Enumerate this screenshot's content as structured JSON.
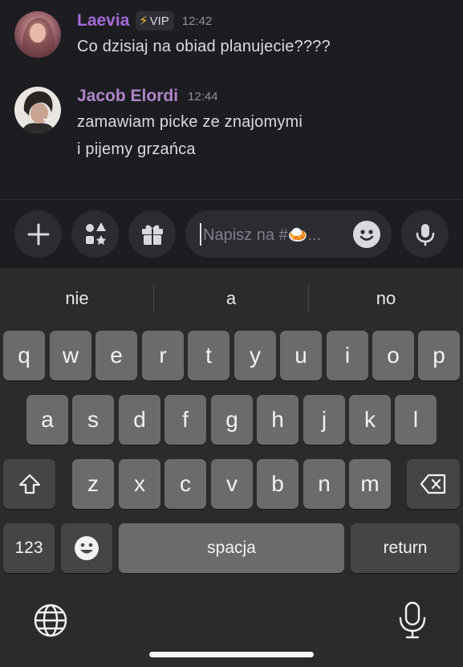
{
  "chat": {
    "messages": [
      {
        "author": "Laevia",
        "badge": {
          "icon": "lightning-bolt-icon",
          "glyph": "⚡",
          "label": "VIP"
        },
        "time": "12:42",
        "lines": [
          "Co dzisiaj na obiad planujecie????"
        ]
      },
      {
        "author": "Jacob Elordi",
        "time": "12:44",
        "lines": [
          "zamawiam picke ze znajomymi",
          "i pijemy grzańca"
        ]
      }
    ]
  },
  "composer": {
    "placeholder": "Napisz na #🍛...",
    "buttons": [
      "plus-icon",
      "apps-icon",
      "gift-icon",
      "emoji-icon",
      "microphone-icon"
    ]
  },
  "keyboard": {
    "suggestions": [
      "nie",
      "a",
      "no"
    ],
    "rows": [
      [
        "q",
        "w",
        "e",
        "r",
        "t",
        "y",
        "u",
        "i",
        "o",
        "p"
      ],
      [
        "a",
        "s",
        "d",
        "f",
        "g",
        "h",
        "j",
        "k",
        "l"
      ],
      [
        "z",
        "x",
        "c",
        "v",
        "b",
        "n",
        "m"
      ]
    ],
    "numbers_label": "123",
    "space_label": "spacja",
    "return_label": "return"
  },
  "colors": {
    "background": "#1c1c21",
    "keyboard_bg": "#2b2b2d",
    "key": "#6b6b6e",
    "key_dark": "#454547",
    "author_laevia": "#a46ad6",
    "author_jacob": "#b086c8",
    "vip_bolt": "#f1c232"
  }
}
